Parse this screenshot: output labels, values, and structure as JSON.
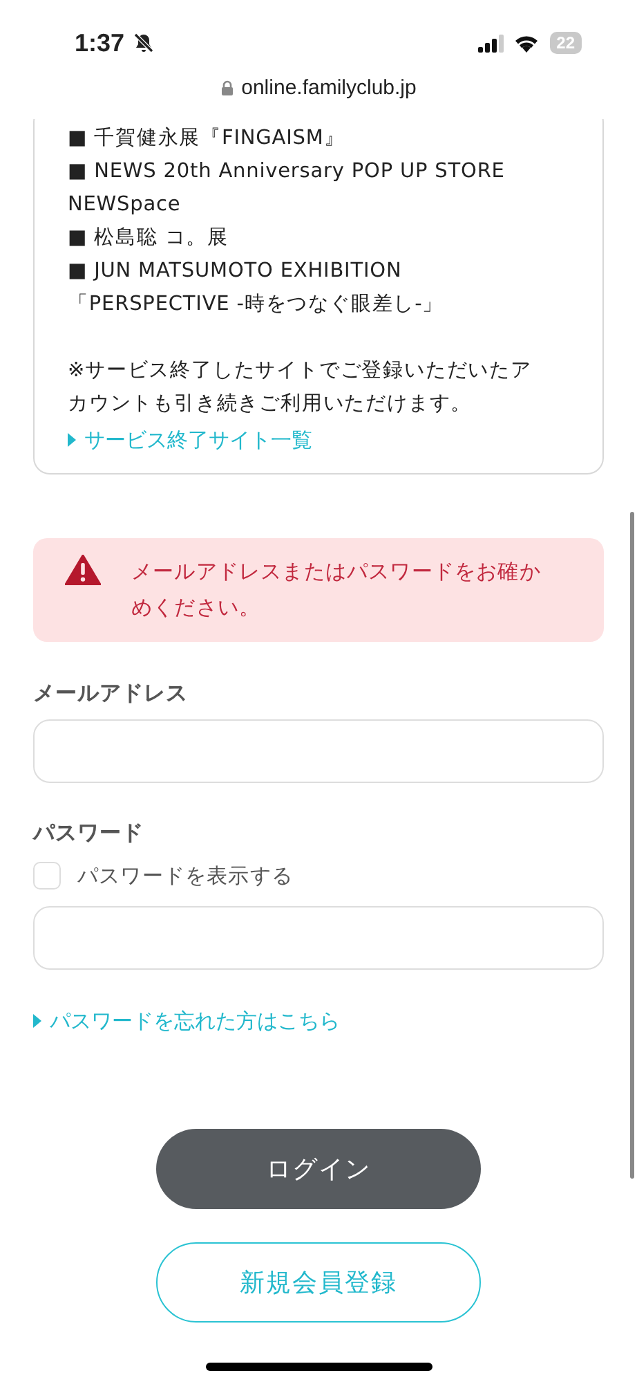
{
  "status_bar": {
    "time": "1:37",
    "battery": "22"
  },
  "address_bar": {
    "url": "online.familyclub.jp"
  },
  "notice_card": {
    "lines": [
      "■ 千賀健永展『FINGAISM』",
      "■ NEWS 20th Anniversary POP UP STORE NEWSpace",
      "■ 松島聡 コ。展",
      "■ JUN MATSUMOTO EXHIBITION",
      "「PERSPECTIVE -時をつなぐ眼差し-」"
    ],
    "note": "※サービス終了したサイトでご登録いただいたアカウントも引き続きご利用いただけます。",
    "link": "サービス終了サイト一覧"
  },
  "error_alert": {
    "message": "メールアドレスまたはパスワードをお確かめください。"
  },
  "form": {
    "email_label": "メールアドレス",
    "password_label": "パスワード",
    "show_password": {
      "label": "パスワードを表示する",
      "checked": false
    },
    "forgot_link": "パスワードを忘れた方はこちら"
  },
  "buttons": [
    {
      "kind": "primary",
      "label": "ログイン"
    },
    {
      "kind": "outline",
      "label": "新規会員登録"
    }
  ]
}
